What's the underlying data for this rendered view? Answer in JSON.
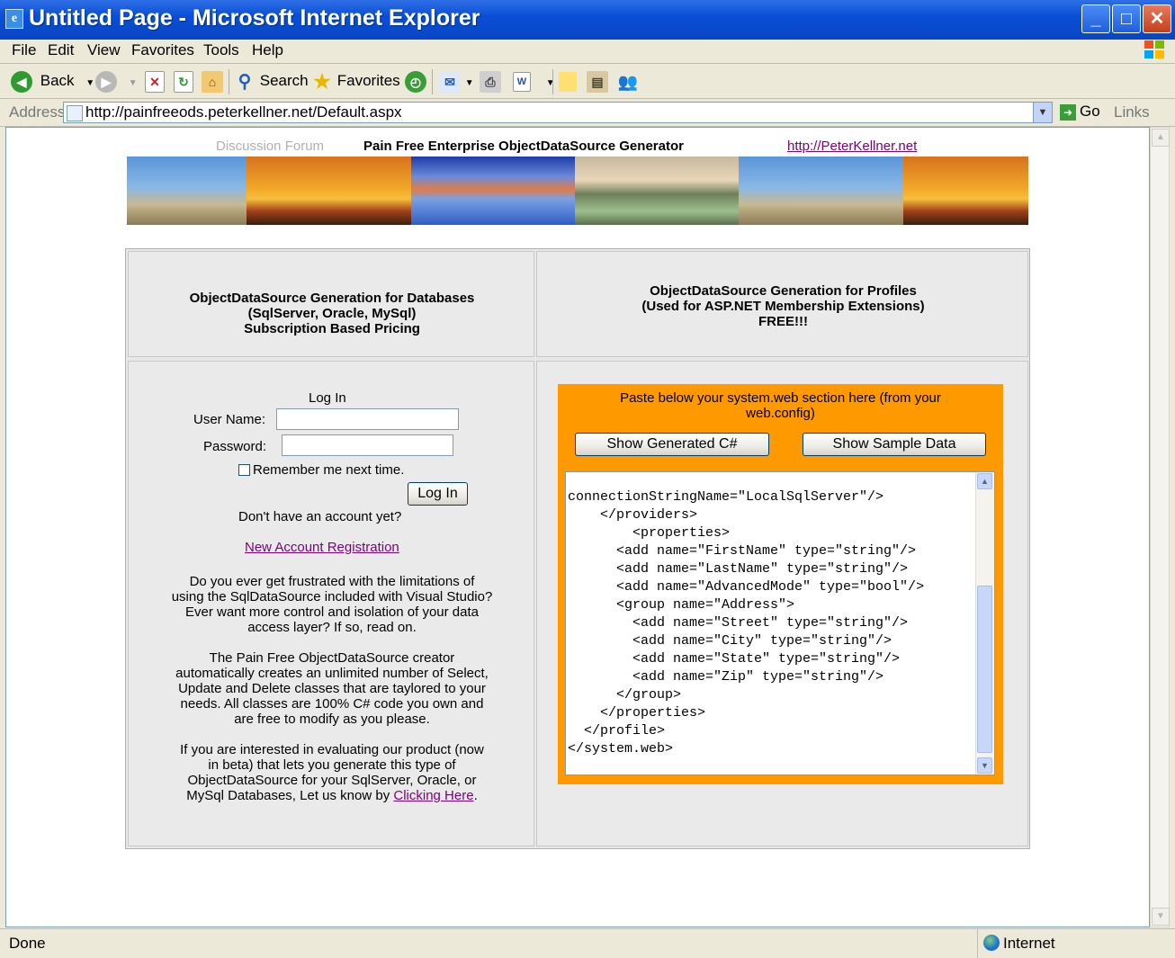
{
  "window": {
    "title": "Untitled Page - Microsoft Internet Explorer",
    "controls": {
      "minimize": "_",
      "maximize": "□",
      "close": "✕"
    }
  },
  "menu": [
    "File",
    "Edit",
    "View",
    "Favorites",
    "Tools",
    "Help"
  ],
  "toolbar": {
    "back": "Back",
    "search": "Search",
    "favorites": "Favorites"
  },
  "address": {
    "label": "Address",
    "url": "http://painfreeods.peterkellner.net/Default.aspx",
    "go": "Go",
    "links": "Links"
  },
  "page": {
    "header": {
      "forum": "Discussion Forum",
      "title": "Pain Free Enterprise ObjectDataSource Generator",
      "site_link": "http://PeterKellner.net"
    },
    "left_heading": [
      "ObjectDataSource Generation for Databases",
      "(SqlServer, Oracle, MySql)",
      "Subscription Based Pricing"
    ],
    "right_heading": [
      "ObjectDataSource Generation for Profiles",
      "(Used for ASP.NET Membership Extensions)",
      "FREE!!!"
    ],
    "login": {
      "title": "Log In",
      "username_label": "User Name:",
      "username_value": "",
      "password_label": "Password:",
      "password_value": "",
      "remember_label": "Remember me next time.",
      "button": "Log In",
      "no_account": "Don't have an account yet?",
      "register_link": "New Account Registration"
    },
    "paragraphs": {
      "p1": [
        "Do you ever get frustrated with the limitations of",
        "using the SqlDataSource included with Visual Studio?",
        "Ever want more control and isolation of your data",
        "access layer?  If so, read on."
      ],
      "p2": [
        "The Pain Free ObjectDataSource creator",
        "automatically creates an unlimited number of Select,",
        "Update and Delete classes that are taylored to your",
        "needs.   All classes are 100% C# code you own and",
        "are free to modify as you please."
      ],
      "p3": [
        "If you are interested in evaluating our product (now",
        "in beta) that lets you generate this type of",
        "ObjectDataSource for your SqlServer, Oracle, or"
      ],
      "p3_last_prefix": "MySql Databases, Let us know by ",
      "p3_link": "Clicking Here",
      "p3_suffix": "."
    },
    "profile": {
      "instructions": [
        "Paste below your system.web section here (from your",
        "web.config)"
      ],
      "btn_generate": "Show Generated C#",
      "btn_sample": "Show Sample Data",
      "code": "connectionStringName=\"LocalSqlServer\"/>\n    </providers>\n        <properties>\n      <add name=\"FirstName\" type=\"string\"/>\n      <add name=\"LastName\" type=\"string\"/>\n      <add name=\"AdvancedMode\" type=\"bool\"/>\n      <group name=\"Address\">\n        <add name=\"Street\" type=\"string\"/>\n        <add name=\"City\" type=\"string\"/>\n        <add name=\"State\" type=\"string\"/>\n        <add name=\"Zip\" type=\"string\"/>\n      </group>\n    </properties>\n  </profile>\n</system.web>"
    }
  },
  "status": {
    "text": "Done",
    "zone": "Internet"
  },
  "colors": {
    "titlebar": "#0a4fd6",
    "panel_orange": "#ff9900",
    "link_visited": "#800080"
  }
}
